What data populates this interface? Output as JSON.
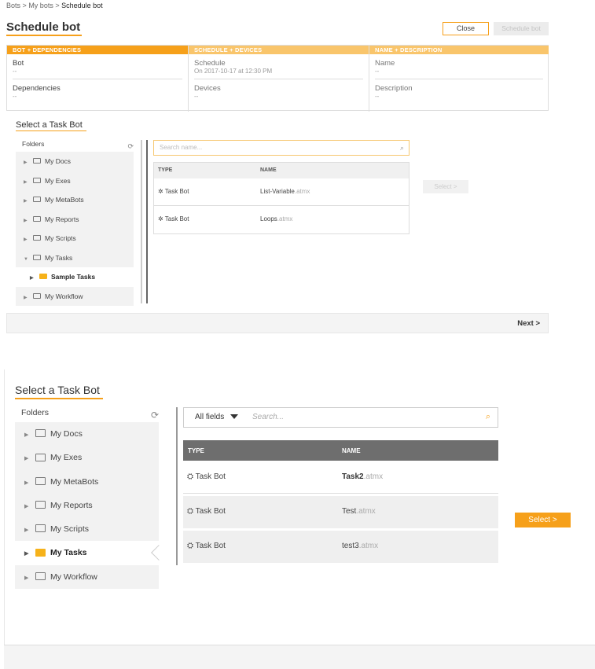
{
  "top": {
    "breadcrumb": [
      "Bots",
      "My bots",
      "Schedule bot"
    ],
    "breadcrumb_sep": ">",
    "title": "Schedule bot",
    "close_label": "Close",
    "schedule_label": "Schedule bot",
    "steps": [
      {
        "header": "BOT + DEPENDENCIES",
        "color": "#f6a01a",
        "fields": [
          {
            "label": "Bot",
            "value": "--"
          },
          {
            "label": "Dependencies",
            "value": "--"
          }
        ]
      },
      {
        "header": "SCHEDULE + DEVICES",
        "color": "#f9c56b",
        "fields": [
          {
            "label": "Schedule",
            "value": "On 2017-10-17 at 12:30 PM"
          },
          {
            "label": "Devices",
            "value": "--"
          }
        ]
      },
      {
        "header": "NAME + DESCRIPTION",
        "color": "#f9c56b",
        "fields": [
          {
            "label": "Name",
            "value": "--"
          },
          {
            "label": "Description",
            "value": "--"
          }
        ]
      }
    ],
    "select_title": "Select a Task Bot",
    "folders_label": "Folders",
    "folders": [
      {
        "name": "My Docs",
        "expanded": false
      },
      {
        "name": "My Exes",
        "expanded": false
      },
      {
        "name": "My MetaBots",
        "expanded": false
      },
      {
        "name": "My Reports",
        "expanded": false
      },
      {
        "name": "My Scripts",
        "expanded": false
      },
      {
        "name": "My Tasks",
        "expanded": true
      },
      {
        "name": "Sample Tasks",
        "sub": true
      },
      {
        "name": "My Workflow",
        "expanded": false
      }
    ],
    "search_placeholder": "Search name...",
    "table_headers": [
      "TYPE",
      "NAME"
    ],
    "rows": [
      {
        "type": "Task Bot",
        "name": "List-Variable",
        "ext": ".atmx"
      },
      {
        "type": "Task Bot",
        "name": "Loops",
        "ext": ".atmx"
      }
    ],
    "select_button": "Select >",
    "next_label": "Next >"
  },
  "bottom": {
    "select_title": "Select a Task Bot",
    "folders_label": "Folders",
    "folders": [
      {
        "name": "My Docs"
      },
      {
        "name": "My Exes"
      },
      {
        "name": "My MetaBots"
      },
      {
        "name": "My Reports"
      },
      {
        "name": "My Scripts"
      },
      {
        "name": "My Tasks",
        "active": true
      },
      {
        "name": "My Workflow"
      }
    ],
    "filter_label": "All fields",
    "search_placeholder": "Search...",
    "table_headers": [
      "TYPE",
      "NAME"
    ],
    "rows": [
      {
        "type": "Task Bot",
        "name": "Task2",
        "ext": ".atmx",
        "bold": true
      },
      {
        "type": "Task Bot",
        "name": "Test",
        "ext": ".atmx"
      },
      {
        "type": "Task Bot",
        "name": "test3",
        "ext": ".atmx"
      }
    ],
    "select_button": "Select >"
  },
  "colors": {
    "accent": "#f6a01a",
    "accent_light": "#f9c56b",
    "header_dark": "#6e6e6e"
  },
  "icons": [
    "refresh-icon",
    "folder-icon",
    "search-icon",
    "bot-icon",
    "chevron-right-icon"
  ]
}
